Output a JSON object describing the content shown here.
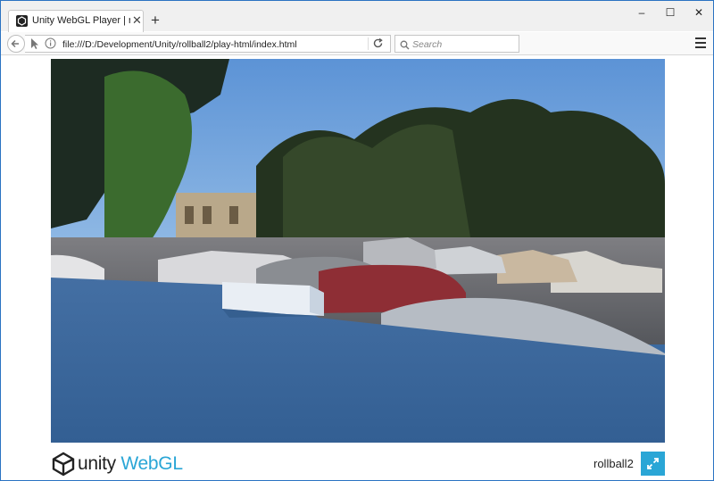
{
  "browser": {
    "tab_title": "Unity WebGL Player | rollb...",
    "tab_close_icon": "close-icon",
    "new_tab_label": "+",
    "url": "file:///D:/Development/Unity/rollball2/play-html/index.html",
    "search_placeholder": "Search",
    "window_controls": [
      "minimize-icon",
      "maximize-icon",
      "close-icon"
    ]
  },
  "unity": {
    "logo_text": "unity",
    "logo_suffix": "WebGL",
    "game_title": "rollball2",
    "accent_color": "#2aa6d6"
  },
  "scene": {
    "ground_color": "#3a6aa1",
    "sky_color": "#5a8fd0"
  }
}
